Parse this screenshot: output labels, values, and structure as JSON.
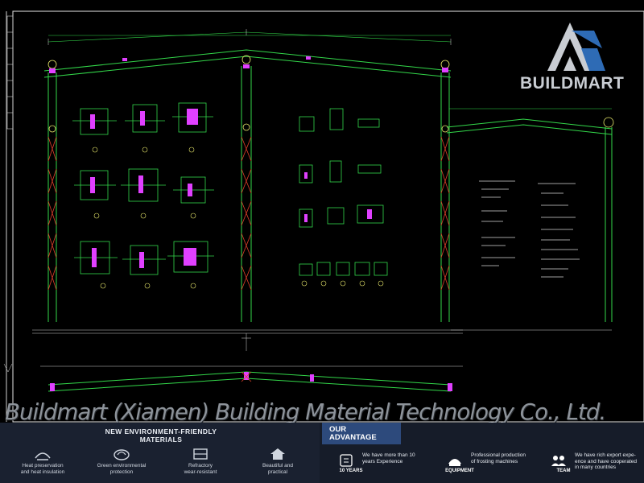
{
  "brand": {
    "logo_word": "BUILDMART",
    "colors": {
      "accent_blue": "#2e6bb5",
      "logo_grey": "#c9cdd3",
      "cad_green": "#33d84a",
      "cad_magenta": "#e040ff",
      "cad_red": "#e0402a",
      "panel_bg": "#161c29",
      "advantage_bg": "#2d4a7c"
    }
  },
  "banner": {
    "company": "Buildmart (Xiamen) Building Material Technology Co., Ltd."
  },
  "left_panel": {
    "title_line1": "NEW ENVIRONMENT-FRIENDLY",
    "title_line2": "MATERIALS",
    "features": [
      {
        "icon": "heat-preservation-icon",
        "line1": "Heat preservation",
        "line2": "and heat insulation"
      },
      {
        "icon": "green-environment-icon",
        "line1": "Green environmental",
        "line2": "protection"
      },
      {
        "icon": "refractory-icon",
        "line1": "Refractory",
        "line2": "wear-resistant"
      },
      {
        "icon": "house-icon",
        "line1": "Beautiful and",
        "line2": "practical"
      }
    ]
  },
  "advantage": {
    "title_line1": "OUR",
    "title_line2": "ADVANTAGE",
    "items": [
      {
        "icon": "experience-icon",
        "label": "10 YEARS",
        "line1": "We have more than 10",
        "line2": "years Experience",
        "line3": ""
      },
      {
        "icon": "equipment-icon",
        "label": "EQUIPMENT",
        "line1": "Professional production",
        "line2": "of frosting machines",
        "line3": ""
      },
      {
        "icon": "team-icon",
        "label": "TEAM",
        "line1": "We have rich export expe-",
        "line2": "ence and have cooperated",
        "line3": "in many countries"
      }
    ]
  }
}
